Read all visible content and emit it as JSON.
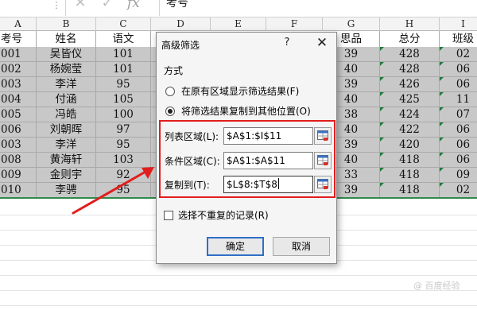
{
  "formula_bar": {
    "namebox": "",
    "dots": "⋮",
    "cancel_icon": "✕",
    "enter_icon": "✓",
    "fx_label": "fx",
    "content": "考号"
  },
  "columns": [
    "A",
    "B",
    "C",
    "D",
    "E",
    "F",
    "G",
    "H",
    "I"
  ],
  "sheet": {
    "headers": {
      "A": "考号",
      "B": "姓名",
      "C": "语文",
      "G": "思品",
      "H": "总分",
      "I": "班级"
    },
    "rows": [
      {
        "A": "001",
        "B": "吴皆仪",
        "C": "101",
        "G": "39",
        "H": "428",
        "I": "02"
      },
      {
        "A": "002",
        "B": "杨婉莹",
        "C": "101",
        "G": "40",
        "H": "428",
        "I": "06"
      },
      {
        "A": "003",
        "B": "李洋",
        "C": "95",
        "G": "39",
        "H": "426",
        "I": "06"
      },
      {
        "A": "004",
        "B": "付涵",
        "C": "105",
        "G": "40",
        "H": "425",
        "I": "11"
      },
      {
        "A": "005",
        "B": "冯皓",
        "C": "100",
        "G": "38",
        "H": "424",
        "I": "07"
      },
      {
        "A": "006",
        "B": "刘朝晖",
        "C": "97",
        "G": "40",
        "H": "422",
        "I": "06"
      },
      {
        "A": "003",
        "B": "李洋",
        "C": "95",
        "G": "39",
        "H": "420",
        "I": "06"
      },
      {
        "A": "008",
        "B": "黄海轩",
        "C": "103",
        "G": "40",
        "H": "418",
        "I": "06"
      },
      {
        "A": "009",
        "B": "金则宇",
        "C": "92",
        "G": "33",
        "H": "418",
        "I": "09"
      },
      {
        "A": "010",
        "B": "李骋",
        "C": "95",
        "G": "39",
        "H": "418",
        "I": "02"
      }
    ]
  },
  "dialog": {
    "title": "高级筛选",
    "help": "?",
    "close_icon": "✕",
    "method_label": "方式",
    "radio_in_place": "在原有区域显示筛选结果(F)",
    "radio_copy": "将筛选结果复制到其他位置(O)",
    "selected_option": "copy",
    "list_range_label": "列表区域(L):",
    "list_range_value": "$A$1:$I$11",
    "criteria_range_label": "条件区域(C):",
    "criteria_range_value": "$A$1:$A$11",
    "copy_to_label": "复制到(T):",
    "copy_to_value": "$L$8:$T$8",
    "unique_label": "选择不重复的记录(R)",
    "unique_checked": false,
    "ok_label": "确定",
    "cancel_label": "取消"
  },
  "colors": {
    "selection_fill": "#c8c8c8",
    "annotation_red": "#e21d1d",
    "default_button_border": "#2f6fc7"
  },
  "watermark": "@ 百度经验"
}
